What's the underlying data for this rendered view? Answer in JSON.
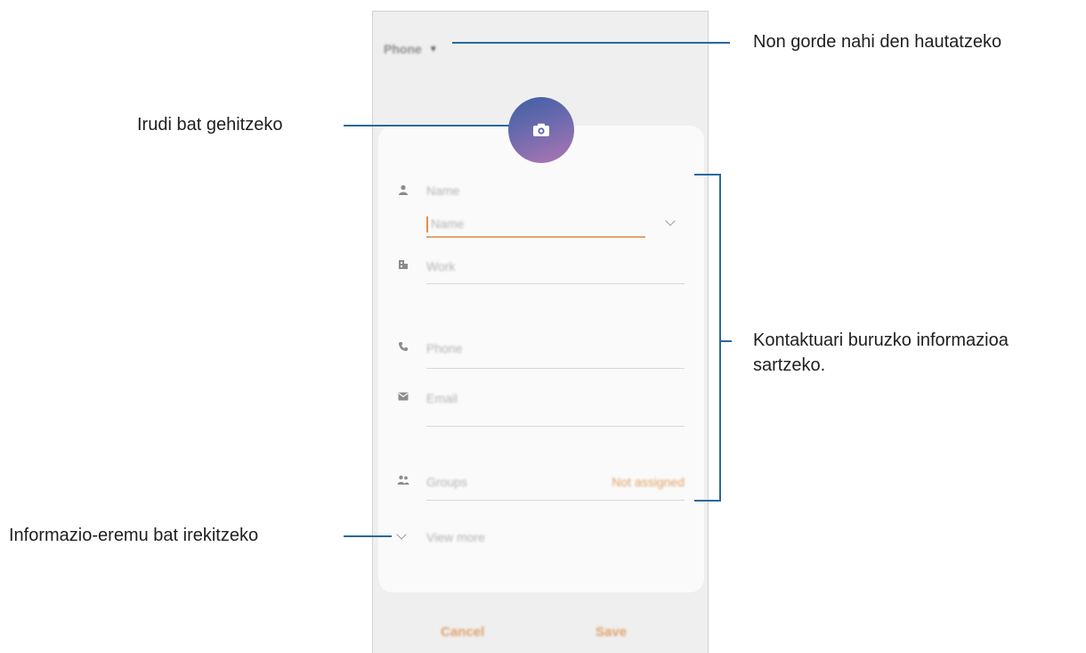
{
  "screen": {
    "storage_selector": "Phone",
    "fields": {
      "name_label": "Name",
      "name_input_placeholder": "Name",
      "work_label": "Work",
      "phone_label": "Phone",
      "email_label": "Email",
      "groups_label": "Groups",
      "groups_value": "Not assigned",
      "view_more_label": "View more"
    },
    "buttons": {
      "cancel": "Cancel",
      "save": "Save"
    },
    "icons": {
      "storage_arrow": "caret-down-icon",
      "photo": "camera-icon",
      "name": "person-icon",
      "work": "building-icon",
      "phone": "phone-icon",
      "email": "envelope-icon",
      "groups": "people-icon",
      "expand": "chevron-down-icon"
    },
    "colors": {
      "accent": "#e0a067",
      "photo_gradient_start": "#3e5fa2",
      "photo_gradient_end": "#b076b2"
    }
  },
  "annotations": {
    "storage": "Non gorde nahi den hautatzeko",
    "image": "Irudi bat gehitzeko",
    "contact_info_line1": "Kontaktuari buruzko informazioa",
    "contact_info_line2": "sartzeko.",
    "open_field": "Informazio-eremu bat irekitzeko",
    "leader_color": "#2a68a0"
  }
}
